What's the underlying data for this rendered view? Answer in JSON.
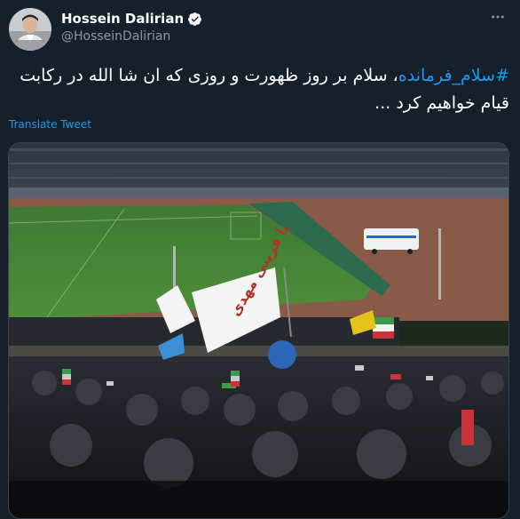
{
  "tweet": {
    "display_name": "Hossein Dalirian",
    "handle": "@HosseinDalirian",
    "hashtag": "#سلام_فرمانده",
    "text_rest": "، سلام بر روز ظهورت و روزی که ان شا الله در رکابت قیام خواهیم کرد ...",
    "translate_label": "Translate Tweet",
    "more_icon": "more-horizontal-icon",
    "verified_icon": "verified-badge-icon"
  },
  "colors": {
    "background": "#15202b",
    "link": "#1d9bf0",
    "secondary_text": "#8b98a5",
    "border": "#38444d"
  },
  "media": {
    "description_icons": [
      "stadium-photo"
    ],
    "banner_text": "یا فریبی مهدی"
  }
}
